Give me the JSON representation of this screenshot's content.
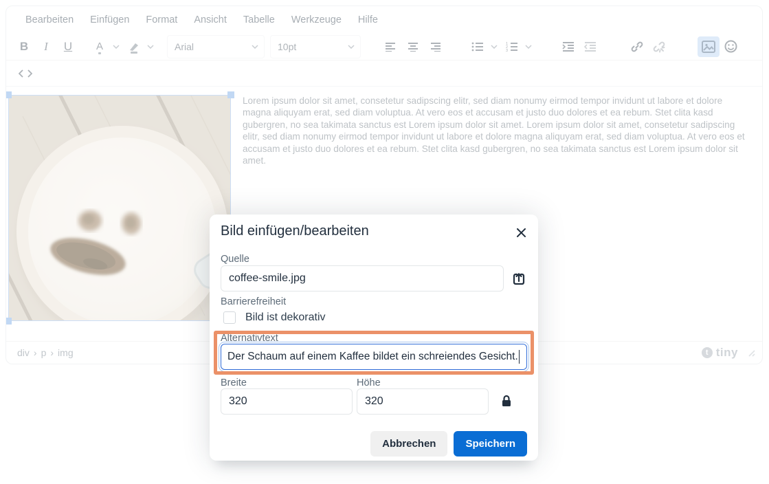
{
  "menubar": {
    "items": [
      "Bearbeiten",
      "Einfügen",
      "Format",
      "Ansicht",
      "Tabelle",
      "Werkzeuge",
      "Hilfe"
    ]
  },
  "toolbar": {
    "bold": "B",
    "italic": "I",
    "underline": "U",
    "forecolor_letter": "A",
    "font_family": "Arial",
    "font_size": "10pt"
  },
  "content": {
    "paragraph": "Lorem ipsum dolor sit amet, consetetur sadipscing elitr, sed diam nonumy eirmod tempor invidunt ut labore et dolore magna aliquyam erat, sed diam voluptua. At vero eos et accusam et justo duo dolores et ea rebum. Stet clita kasd gubergren, no sea takimata sanctus est Lorem ipsum dolor sit amet. Lorem ipsum dolor sit amet, consetetur sadipscing elitr, sed diam nonumy eirmod tempor invidunt ut labore et dolore magna aliquyam erat, sed diam voluptua. At vero eos et accusam et justo duo dolores et ea rebum. Stet clita kasd gubergren, no sea takimata sanctus est Lorem ipsum dolor sit amet."
  },
  "statusbar": {
    "breadcrumb": [
      "div",
      "p",
      "img"
    ],
    "separator": "›",
    "brand": "tiny"
  },
  "dialog": {
    "title": "Bild einfügen/bearbeiten",
    "source": {
      "label": "Quelle",
      "value": "coffee-smile.jpg"
    },
    "accessibility": {
      "label": "Barrierefreiheit",
      "checkbox_label": "Bild ist dekorativ",
      "checked": false
    },
    "alt": {
      "label": "Alternativtext",
      "value": "Der Schaum auf einem Kaffee bildet ein schreiendes Gesicht."
    },
    "size": {
      "width_label": "Breite",
      "width_value": "320",
      "height_label": "Höhe",
      "height_value": "320"
    },
    "buttons": {
      "cancel": "Abbrechen",
      "save": "Speichern"
    }
  },
  "colors": {
    "primary_button": "#0a6dd4",
    "annotation_highlight": "#eb9168",
    "focus_ring": "#2e6bd8",
    "active_toolbar_bg": "#b9d3f1"
  },
  "icons": {
    "close-icon": "✕",
    "chevron-down-icon": "⌄",
    "code-icon": "<>",
    "upload-icon": "box with up arrow",
    "lock-icon": "closed padlock",
    "link-icon": "chain",
    "unlink-icon": "broken chain",
    "image-icon": "picture frame",
    "emoji-icon": "smiley face",
    "brand-icon": "tiny logo circle",
    "resize-grip-icon": "diagonal grip lines"
  }
}
